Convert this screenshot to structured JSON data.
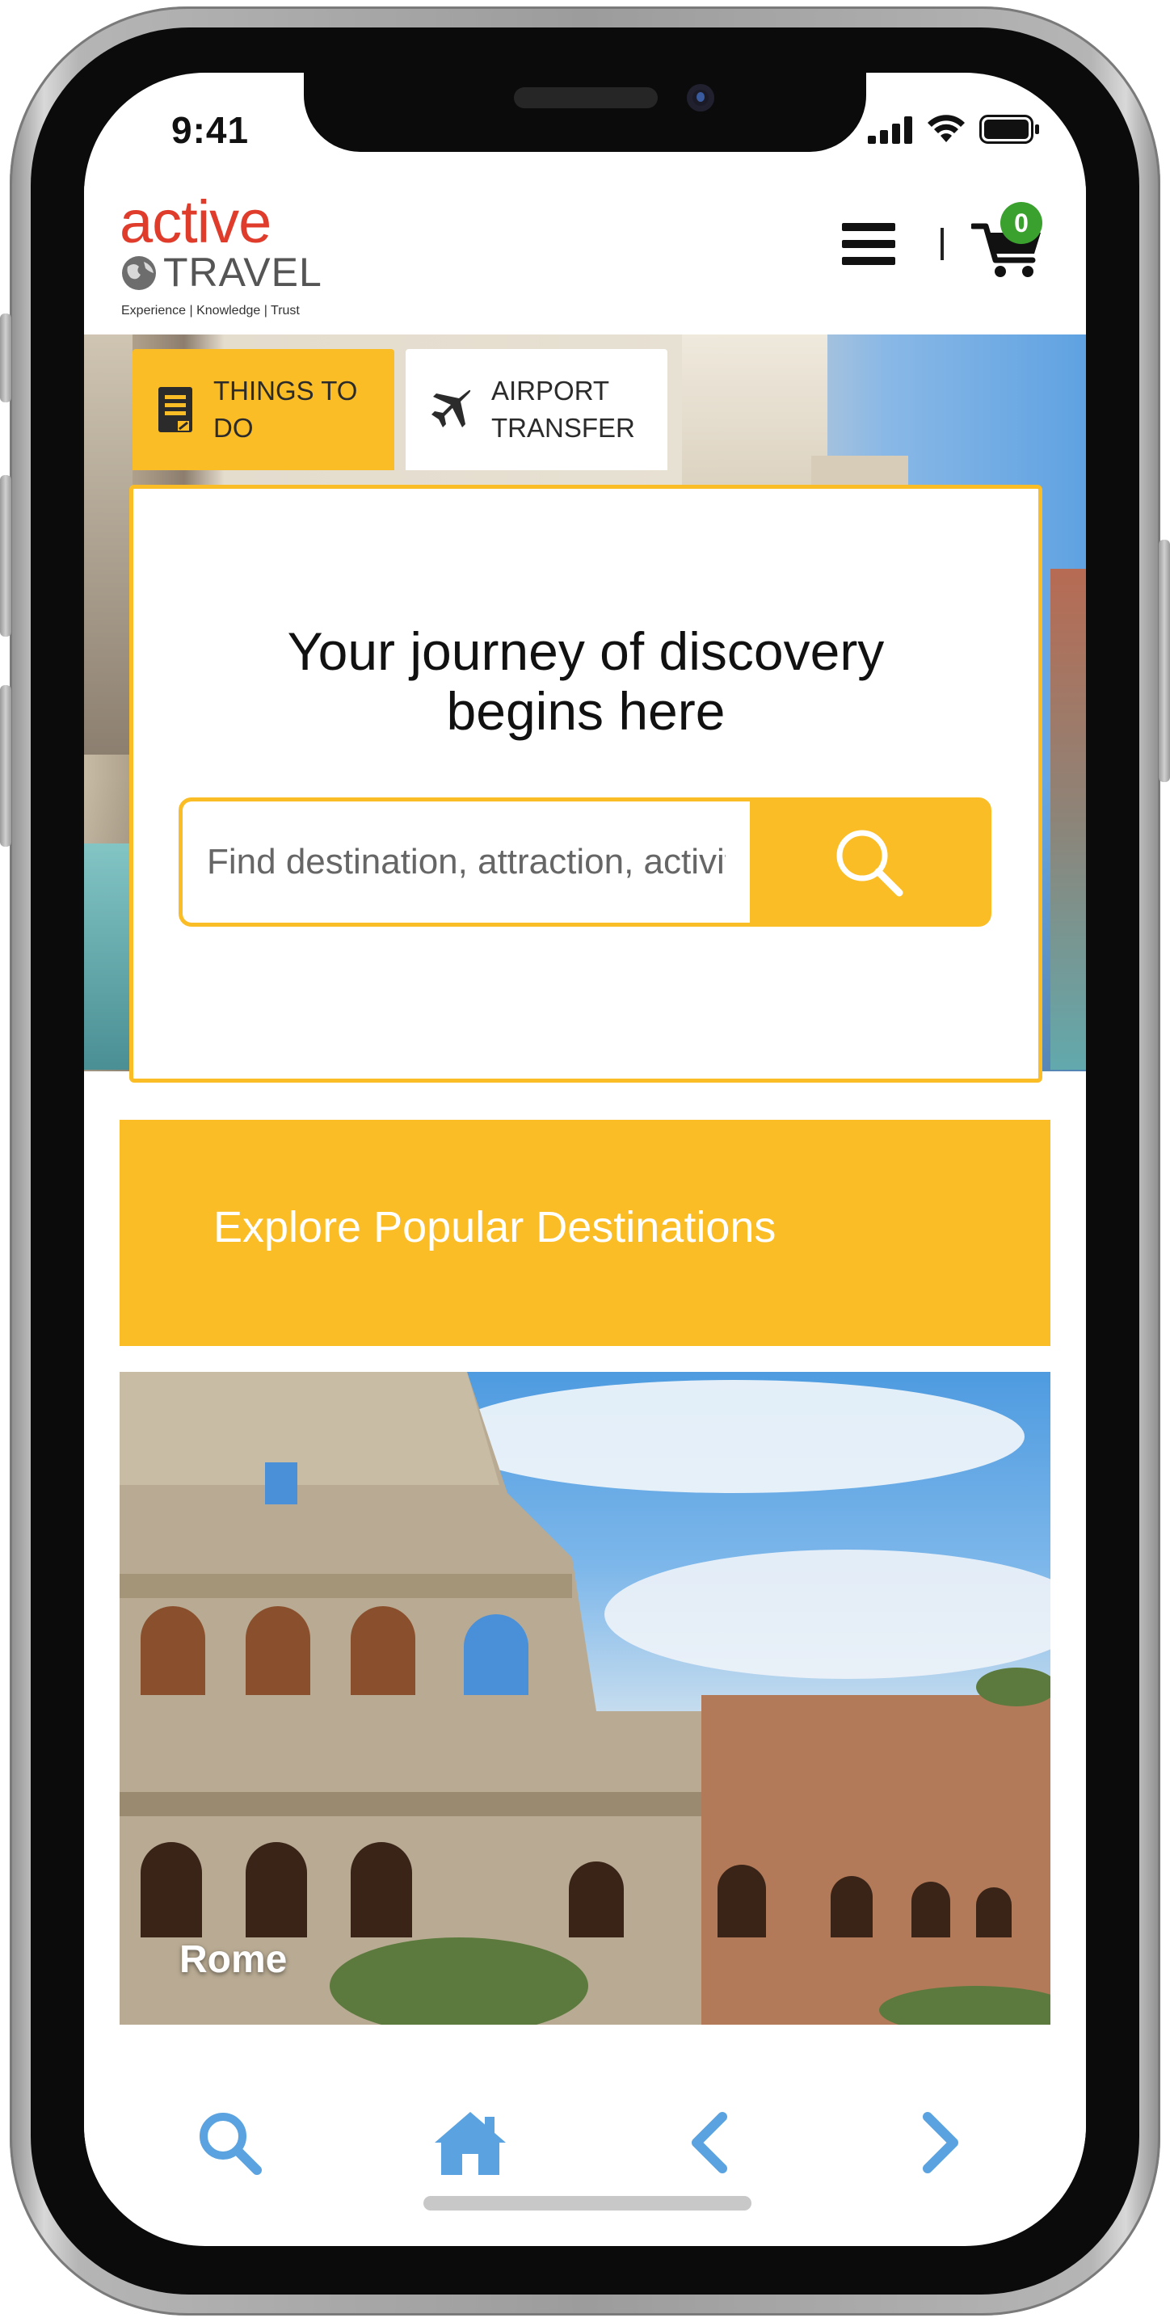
{
  "status_bar": {
    "time": "9:41"
  },
  "header": {
    "logo": {
      "word1": "active",
      "word2": "TRAVEL",
      "tagline": "Experience | Knowledge | Trust"
    },
    "cart_count": "0",
    "divider": "|"
  },
  "tabs": [
    {
      "label_line1": "THINGS TO",
      "label_line2": "DO",
      "icon": "document-icon",
      "active": true
    },
    {
      "label_line1": "AIRPORT",
      "label_line2": "TRANSFER",
      "icon": "airplane-icon",
      "active": false
    }
  ],
  "search": {
    "headline_line1": "Your journey of discovery",
    "headline_line2": "begins here",
    "placeholder": "Find destination, attraction, activity"
  },
  "explore": {
    "title": "Explore Popular Destinations"
  },
  "destinations": [
    {
      "name": "Rome"
    }
  ],
  "bottom_nav": [
    "search-icon",
    "home-icon",
    "chevron-left-icon",
    "chevron-right-icon"
  ],
  "colors": {
    "accent": "#fbbd25",
    "logo_red": "#e03c2c",
    "badge_green": "#3aa02e",
    "nav_blue": "#5aa3e0"
  }
}
